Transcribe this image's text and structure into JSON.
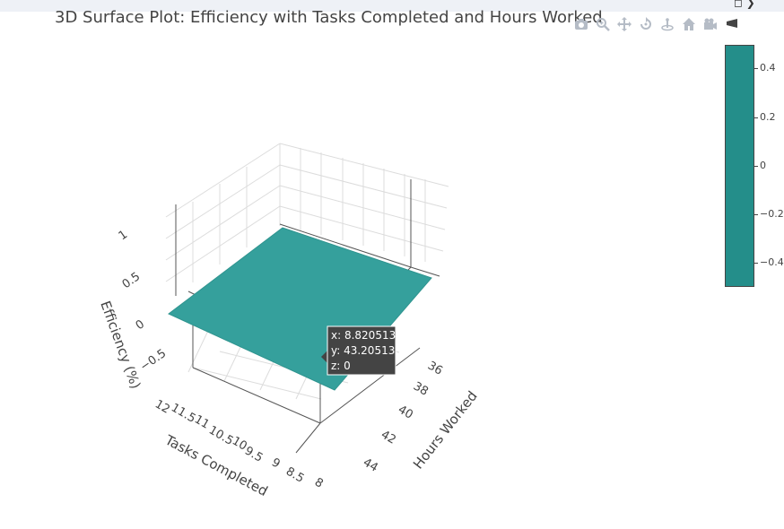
{
  "title": "3D Surface Plot: Efficiency with Tasks Completed and Hours Worked",
  "modebar": {
    "buttons": [
      {
        "name": "camera-icon",
        "label": "Download plot as a png"
      },
      {
        "name": "zoom-icon",
        "label": "Zoom"
      },
      {
        "name": "pan-icon",
        "label": "Pan"
      },
      {
        "name": "orbit-rotation-icon",
        "label": "Orbital rotation"
      },
      {
        "name": "turntable-rotation-icon",
        "label": "Turntable rotation"
      },
      {
        "name": "home-icon",
        "label": "Reset camera to default"
      },
      {
        "name": "camera-view-icon",
        "label": "Reset camera to last save"
      },
      {
        "name": "plotly-logo-icon",
        "label": "Produced with Plotly"
      }
    ]
  },
  "hover": {
    "x": "x: 8.820513",
    "y": "y: 43.20513",
    "z": "z: 0"
  },
  "colors": {
    "surface": "#35a09c",
    "surface_edge": "#2f948f",
    "colorbar": "#248e8a",
    "hover_bg": "#444444",
    "grid": "#d9d9d9",
    "axis": "#444444"
  },
  "chart_data": {
    "type": "surface",
    "title": "3D Surface Plot: Efficiency with Tasks Completed and Hours Worked",
    "xaxis": {
      "title": "Tasks Completed",
      "range": [
        8,
        12
      ],
      "ticks": [
        "8",
        "8.5",
        "9",
        "9.5",
        "10",
        "10.5",
        "11",
        "11.5",
        "12"
      ]
    },
    "yaxis": {
      "title": "Hours Worked",
      "range": [
        35,
        45
      ],
      "ticks": [
        "36",
        "38",
        "40",
        "42",
        "44"
      ]
    },
    "zaxis": {
      "title": "Efficiency (%)",
      "range": [
        -1,
        1
      ],
      "ticks": [
        "−0.5",
        "0",
        "0.5",
        "1"
      ]
    },
    "z_values": "all 0 (flat surface)",
    "colorbar": {
      "ticks": [
        "0.4",
        "0.2",
        "0",
        "−0.2",
        "−0.4"
      ],
      "range": [
        -0.5,
        0.5
      ]
    }
  }
}
